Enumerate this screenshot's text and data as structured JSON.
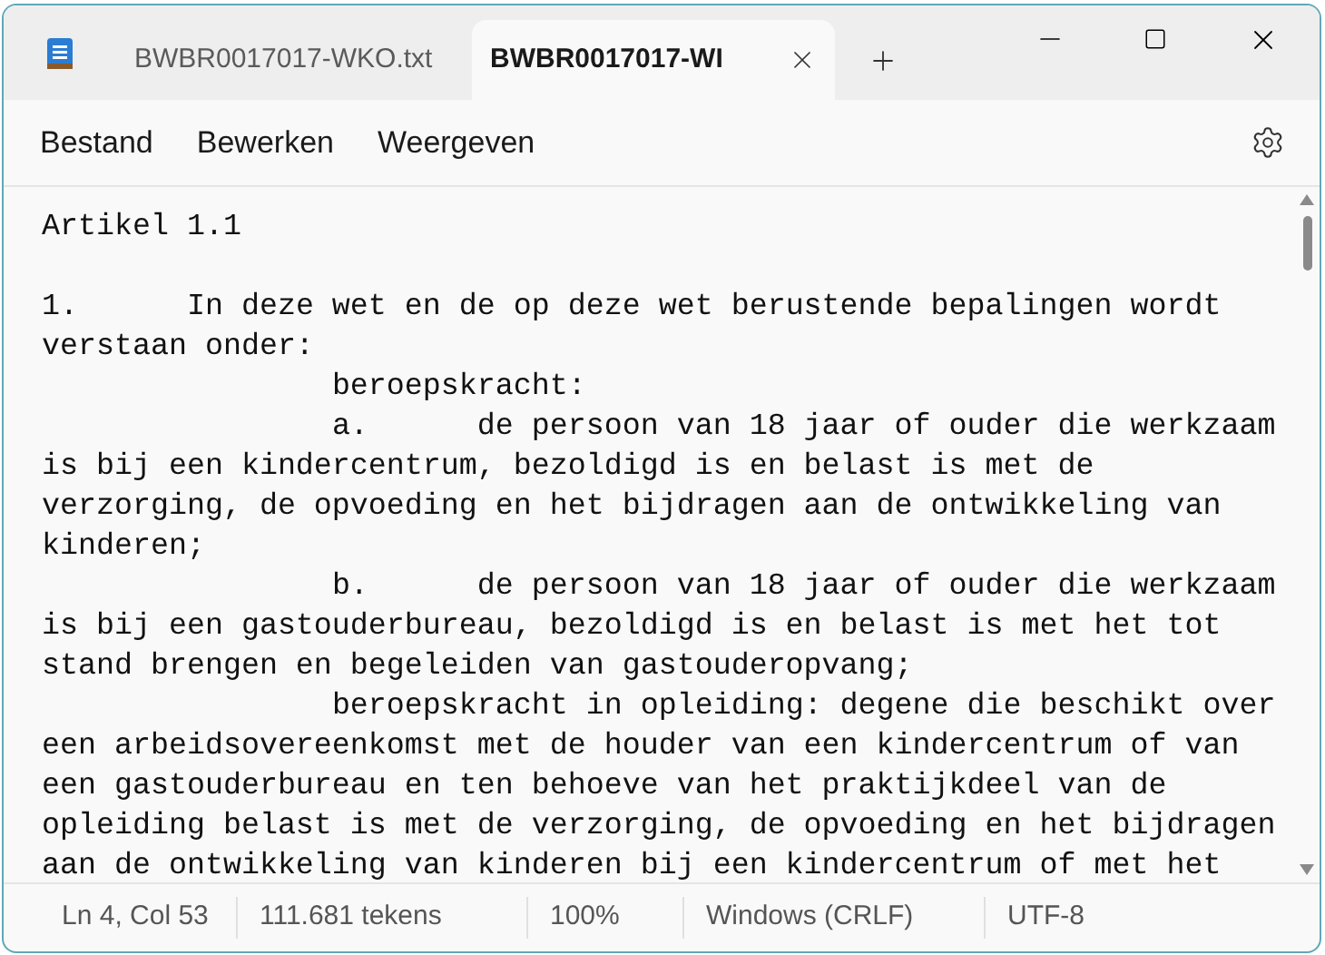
{
  "tabs": [
    {
      "label": "BWBR0017017-WKO.txt",
      "selected": false
    },
    {
      "label": "BWBR0017017-WI",
      "selected": true
    }
  ],
  "menu": [
    "Bestand",
    "Bewerken",
    "Weergeven"
  ],
  "lines": [
    "Artikel 1.1",
    "1.\tIn deze wet en de op deze wet berustende bepalingen wordt verstaan onder:",
    "\t\tberoepskracht:",
    "\t\ta.\tde persoon van 18 jaar of ouder die werkzaam is bij een kindercentrum, bezoldigd is en belast is met de verzorging, de opvoeding en het bijdragen aan de ontwikkeling van kinderen;",
    "\t\tb.\tde persoon van 18 jaar of ouder die werkzaam is bij een gastouderbureau, bezoldigd is en belast is met het tot stand brengen en begeleiden van gastouderopvang;",
    "\t\tberoepskracht in opleiding: degene die beschikt over een arbeidsovereenkomst met de houder van een kindercentrum of van een gastouderbureau en ten behoeve van het praktijkdeel van de opleiding belast is met de verzorging, de opvoeding en het bijdragen aan de ontwikkeling van kinderen bij een kindercentrum of met het"
  ],
  "status_bar": [
    "Ln 4, Col 53",
    "111.681 tekens",
    "100%",
    "Windows (CRLF)",
    "UTF-8"
  ]
}
